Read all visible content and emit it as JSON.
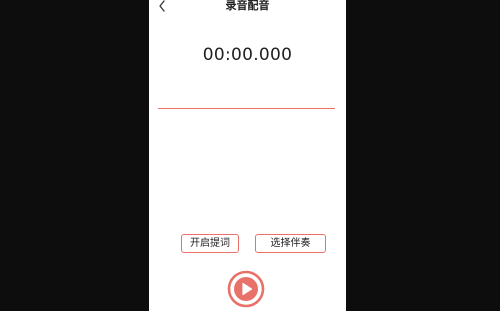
{
  "header": {
    "title": "录音配音",
    "back_icon": "chevron-left-icon"
  },
  "timer": {
    "value": "00:00.000"
  },
  "actions": {
    "prompt_label": "开启提词",
    "accompaniment_label": "选择伴奏"
  },
  "record": {
    "icon": "record-play-icon"
  },
  "colors": {
    "accent": "#E8726A",
    "background": "#FFFFFF",
    "outer": "#0D0D0D"
  }
}
